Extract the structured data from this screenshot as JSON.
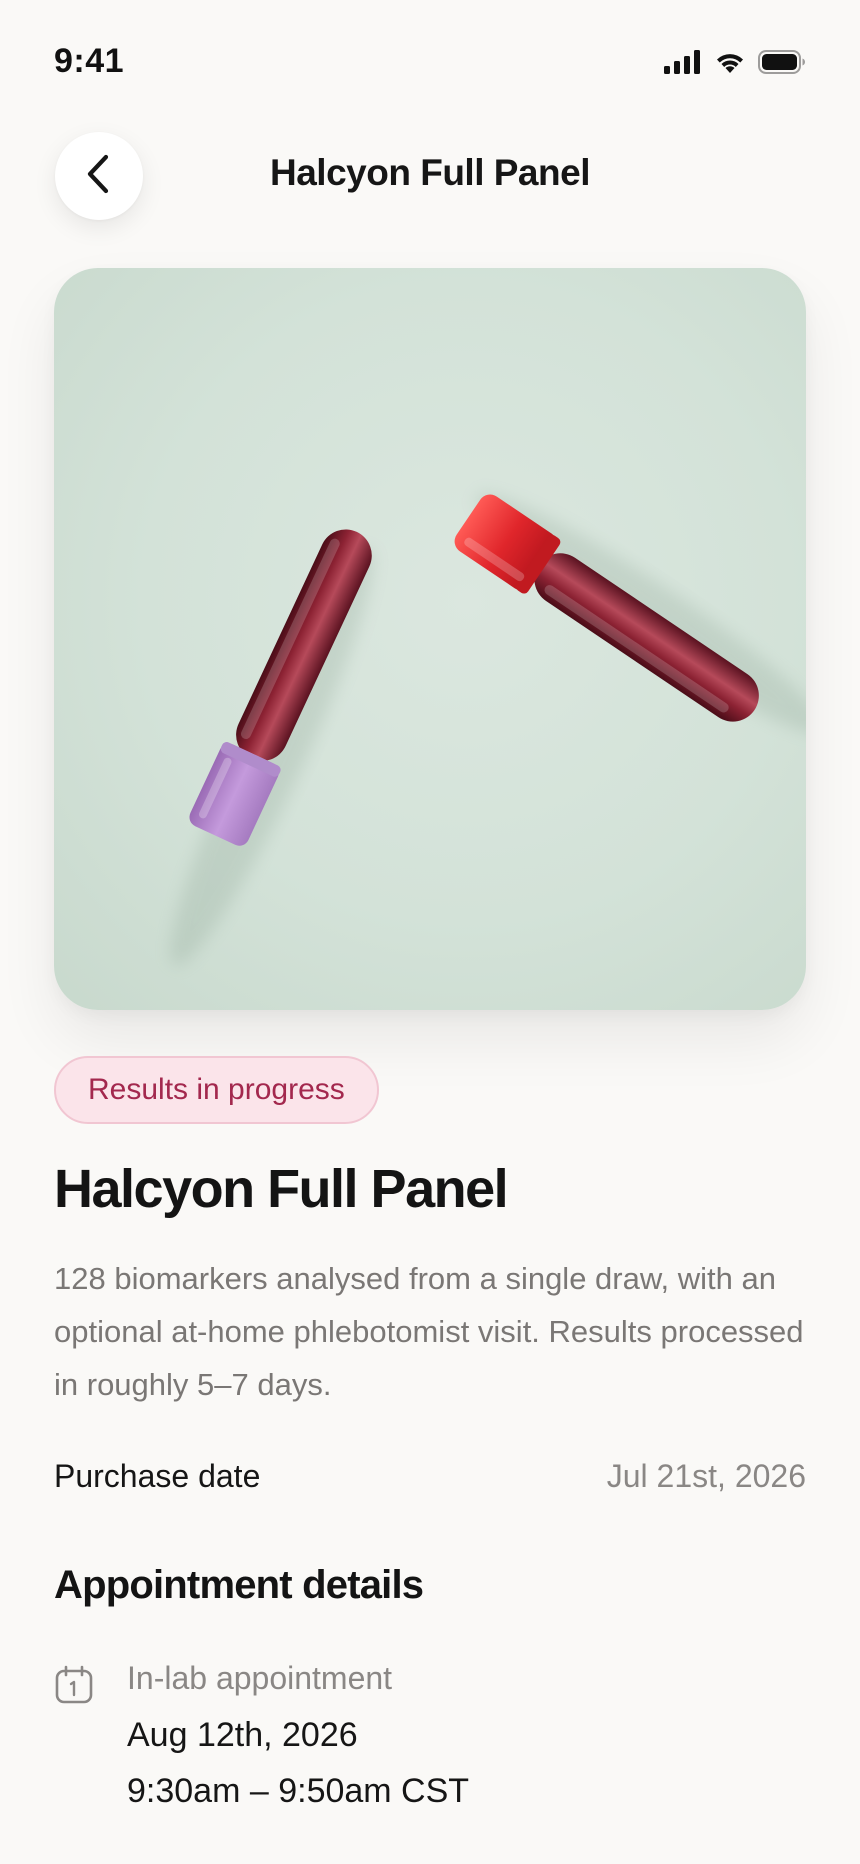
{
  "status_bar": {
    "time": "9:41",
    "icons": [
      "cellular-signal-icon",
      "wifi-icon",
      "battery-icon"
    ]
  },
  "header": {
    "back_icon": "chevron-left-icon",
    "title": "Halcyon Full Panel"
  },
  "hero": {
    "image_description_icon": "blood-test-tubes-image"
  },
  "badge": {
    "label": "Results in progress",
    "color": "#a3284e",
    "background": "#fbe4ea"
  },
  "product": {
    "title": "Halcyon Full Panel",
    "description": "128 biomarkers analysed from a single draw, with an optional at-home phlebotomist visit. Results processed in roughly 5–7 days."
  },
  "purchase": {
    "label": "Purchase date",
    "value": "Jul 21st, 2026"
  },
  "appointment": {
    "section_title": "Appointment details",
    "icon": "calendar-icon",
    "type": "In-lab appointment",
    "date": "Aug 12th, 2026",
    "time": "9:30am – 9:50am CST"
  },
  "colors": {
    "background": "#faf9f7",
    "text_primary": "#161616",
    "text_secondary": "#8a8785",
    "hero_bg": "#d3e2d8",
    "red_cap": "#e0262b",
    "purple_cap": "#b88ad0"
  }
}
